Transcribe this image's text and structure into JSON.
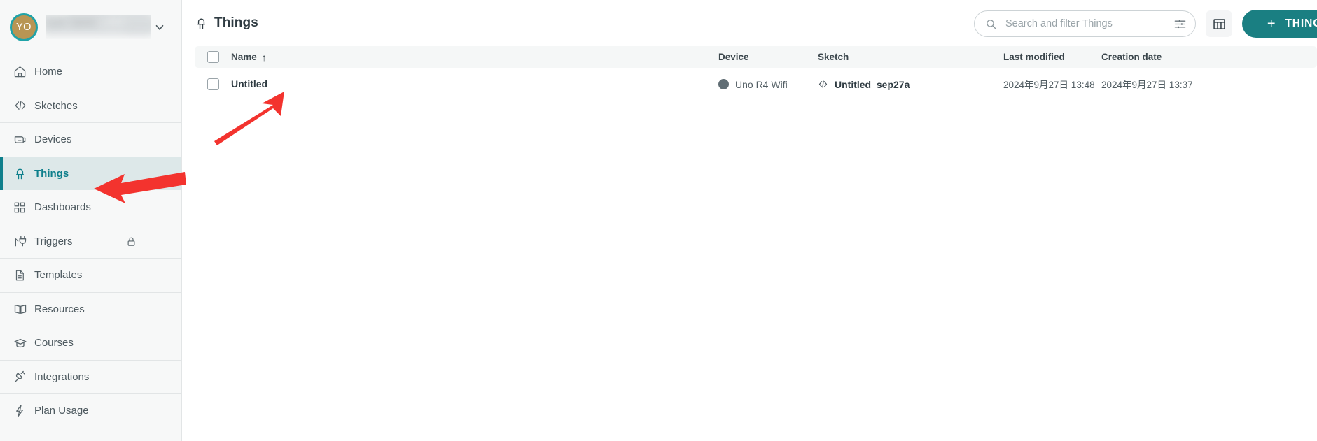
{
  "colors": {
    "accent_teal": "#1a7f82",
    "active_text": "#0e7f8c",
    "active_bg": "#dde8e9",
    "sidebar_bg": "#f7f8f8",
    "avatar_fill": "#b89553",
    "avatar_ring": "#1fa3a8",
    "status_dot_offline": "#606d74",
    "annotation_red": "#f3332e",
    "table_header_bg": "#f5f7f7"
  },
  "sidebar": {
    "account": {
      "avatar_initials": "YO",
      "username_redacted": true,
      "expand_label": "chevron-down"
    },
    "items": [
      {
        "label": "Home",
        "icon": "home-icon",
        "active": false,
        "locked": false,
        "divider_above": false
      },
      {
        "label": "Sketches",
        "icon": "code-icon",
        "active": false,
        "locked": false,
        "divider_above": true
      },
      {
        "label": "Devices",
        "icon": "board-icon",
        "active": false,
        "locked": false,
        "divider_above": true
      },
      {
        "label": "Things",
        "icon": "led-icon",
        "active": true,
        "locked": false,
        "divider_above": false
      },
      {
        "label": "Dashboards",
        "icon": "dashboard-icon",
        "active": false,
        "locked": false,
        "divider_above": false
      },
      {
        "label": "Triggers",
        "icon": "trigger-plug-icon",
        "active": false,
        "locked": true,
        "divider_above": false
      },
      {
        "label": "Templates",
        "icon": "template-icon",
        "active": false,
        "locked": false,
        "divider_above": true
      },
      {
        "label": "Resources",
        "icon": "book-icon",
        "active": false,
        "locked": false,
        "divider_above": true
      },
      {
        "label": "Courses",
        "icon": "graduation-icon",
        "active": false,
        "locked": false,
        "divider_above": false
      },
      {
        "label": "Integrations",
        "icon": "plug-icon",
        "active": false,
        "locked": false,
        "divider_above": true
      },
      {
        "label": "Plan Usage",
        "icon": "bolt-icon",
        "active": false,
        "locked": false,
        "divider_above": true
      }
    ]
  },
  "header": {
    "title": "Things",
    "title_icon": "led-icon",
    "search": {
      "placeholder": "Search and filter Things",
      "value": "",
      "search_icon": "search-icon",
      "filter_icon": "filter-sliders-icon"
    },
    "columns_button": {
      "label": "",
      "icon": "table-columns-icon"
    },
    "new_thing_button": {
      "label": "THING",
      "plus": "+"
    }
  },
  "table": {
    "select_all": false,
    "sort_column": "Name",
    "sort_direction": "asc",
    "sort_arrow_glyph": "↑",
    "columns": [
      {
        "key": "name",
        "label": "Name",
        "sortable": true
      },
      {
        "key": "device",
        "label": "Device",
        "sortable": true
      },
      {
        "key": "sketch",
        "label": "Sketch",
        "sortable": true
      },
      {
        "key": "modified",
        "label": "Last modified",
        "sortable": true
      },
      {
        "key": "created",
        "label": "Creation date",
        "sortable": true
      }
    ],
    "rows": [
      {
        "selected": false,
        "name": "Untitled",
        "device": "Uno R4 Wifi",
        "device_status": "offline",
        "sketch": "Untitled_sep27a",
        "sketch_icon": "code-icon",
        "modified": "2024年9月27日 13:48",
        "created": "2024年9月27日 13:37"
      }
    ],
    "row_count": 1
  },
  "annotations": [
    {
      "name": "arrow-to-untitled-row",
      "type": "arrow",
      "color": "#f3332e",
      "points_to": "Untitled"
    },
    {
      "name": "arrow-to-things-nav",
      "type": "arrow",
      "color": "#f3332e",
      "points_to": "Things"
    }
  ]
}
